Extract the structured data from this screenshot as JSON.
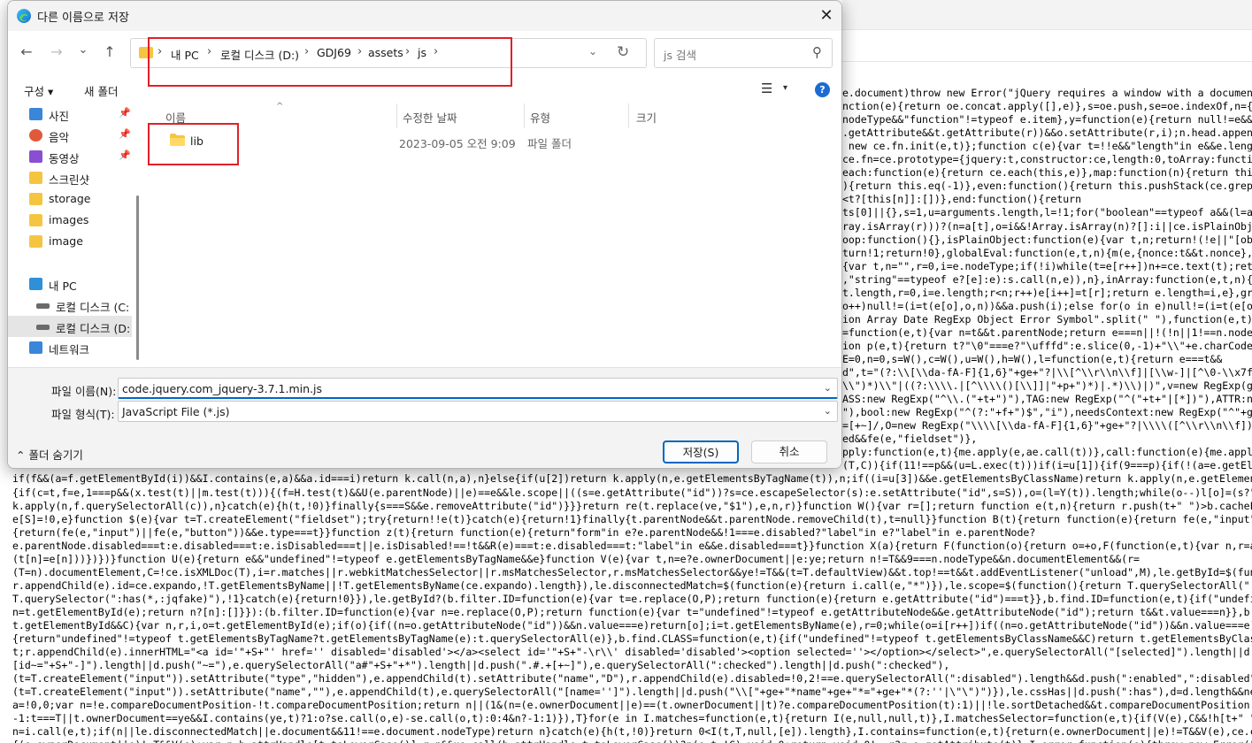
{
  "dialog": {
    "title": "다른 이름으로 저장",
    "close_glyph": "✕"
  },
  "nav": {
    "back": "←",
    "forward": "→",
    "recent": "⌄",
    "up": "↑",
    "breadcrumb": [
      "내 PC",
      "로컬 디스크 (D:)",
      "GDJ69",
      "assets",
      "js"
    ],
    "separator": "›",
    "dropdown": "⌄",
    "refresh": "↻",
    "search_placeholder": "js 검색",
    "search_icon": "⚲"
  },
  "toolbar": {
    "organize": "구성 ▾",
    "new_folder": "새 폴더",
    "view_icon": "☰",
    "view_dd": "▾",
    "help": "?"
  },
  "sidebar": {
    "items": [
      {
        "label": "사진",
        "icon": "pictures-icon",
        "pinned": true
      },
      {
        "label": "음악",
        "icon": "music-icon",
        "pinned": true
      },
      {
        "label": "동영상",
        "icon": "videos-icon",
        "pinned": true
      },
      {
        "label": "스크린샷",
        "icon": "folder-icon",
        "pinned": false
      },
      {
        "label": "storage",
        "icon": "folder-icon",
        "pinned": false
      },
      {
        "label": "images",
        "icon": "folder-icon",
        "pinned": false
      },
      {
        "label": "image",
        "icon": "folder-icon",
        "pinned": false
      },
      {
        "label": "내 PC",
        "icon": "pc-icon",
        "pinned": false
      },
      {
        "label": "로컬 디스크 (C:",
        "icon": "drive-icon",
        "pinned": false
      },
      {
        "label": "로컬 디스크 (D:",
        "icon": "drive-icon",
        "pinned": false
      },
      {
        "label": "네트워크",
        "icon": "network-icon",
        "pinned": false
      }
    ],
    "pin_glyph": "📌"
  },
  "columns": {
    "name": "이름",
    "modified": "수정한 날짜",
    "type": "유형",
    "size": "크기",
    "sort_arrow": "^"
  },
  "files": [
    {
      "name": "lib",
      "modified": "2023-09-05 오전 9:09",
      "type": "파일 폴더",
      "size": ""
    }
  ],
  "form": {
    "filename_label": "파일 이름(N):",
    "filename_value": "code.jquery.com_jquery-3.7.1.min.js",
    "filetype_label": "파일 형식(T):",
    "filetype_value": "JavaScript File (*.js)",
    "dd_glyph": "⌄",
    "hide_folders": "⌃  폴더 숨기기",
    "save": "저장(S)",
    "cancel": "취소"
  },
  "code": {
    "lines": [
      "e.document)throw new Error(\"jQuery requires a window with a document\");return t(e)}:t(e)}(\"undefined\"!=typeof window?window:this",
      "nction(e){return oe.concat.apply([],e)},s=oe.push,se=oe.indexOf,n={},i=n.toString,ue=n.hasOwnProperty,o=ue.toString,a=o.call(Object)",
      "nodeType&&\"function\"!=typeof e.item},y=function(e){return null!=e&&e===e.window},C=ie.document,u={type:!0,src:!0,nonce:!0",
      ".getAttribute&&t.getAttribute(r))&&o.setAttribute(r,i);n.head.appendChild(o).parentNode.removeChild(o)}function x(e){return",
      " new ce.fn.init(e,t)};function c(e){var t=!!e&&\"length\"in e&&e.length,n=x(e);return!v(e)&&!y(e)&&(\"array\"===n||0===t",
      "ce.fn=ce.prototype={jquery:t,constructor:ce,length:0,toArray:function(){return ae.call(this)},get:function(e){return null",
      "each:function(e){return ce.each(this,e)},map:function(n){return this.pushStack(ce.map(this,function(e,t){return n.call(e,t,e)",
      "){return this.eq(-1)},even:function(){return this.pushStack(ce.grep(this,function(e,t){return(t+1)%2}))},odd:function(){return",
      "<t?[this[n]]:[])},end:function(){return",
      "ts[0]||{},s=1,u=arguments.length,l=!1;for(\"boolean\"==typeof a&&(l=a,a=arguments[s]||{},s++),\"object\"==typeof a||v(a)||(a={})",
      "ray.isArray(r)))?(n=a[t],o=i&&!Array.isArray(n)?[]:i||ce.isPlainObject(n)?n:{},i=!1,a[t]=ce.extend(l,o,r)):void 0!==r&&(a[t]=r)",
      "oop:function(){},isPlainObject:function(e){var t,n;return!(!e||\"[object Object]\"!==i.call(e))&&(!(t=r(e))||\"function\"==typeof",
      "turn!1;return!0},globalEval:function(e,t,n){m(e,{nonce:t&&t.nonce},n)},each:function(e,t){var n,r=0;if(c(e)){for(n=e.length",
      "{var t,n=\"\",r=0,i=e.nodeType;if(!i)while(t=e[r++])n+=ce.text(t);return 1===i||11===i?e.textContent:9===i?e.documentElement",
      ",\"string\"==typeof e?[e]:e):s.call(n,e)),n},inArray:function(e,t,n){return null==t?-1:se.call(t,e,n)},isXMLDoc:function(e){var t",
      "t.length,r=0,i=e.length;r<n;r++)e[i++]=t[r];return e.length=i,e},grep:function(e,t,n){for(var r=[],i=0,o=e.length,a=!n;i<o;i++)",
      "o++)null!=(i=t(e[o],o,n))&&a.push(i);else for(o in e)null!=(i=t(e[o],o,n))&&a.push(i);return g(a)},guid:1,support:le}),",
      "ion Array Date RegExp Object Error Symbol\".split(\" \"),function(e,t){n[\"[object \"+t+\"]\"]=t.toLowerCase()});var pe=oe.pop",
      "=function(e,t){var n=t&&t.parentNode;return e===n||!(!n||1!==n.nodeType||!(e.contains?e.contains(n):e.compareDocumentPosition",
      "ion p(e,t){return t?\"\\0\"===e?\"\\ufffd\":e.slice(0,-1)+\"\\\\\"+e.charCodeAt(e.length-1).toString(16)+\" \":\"\\\\\"+e}ce.escapeSelector",
      "E=0,n=0,s=W(),c=W(),u=W(),h=W(),l=function(e,t){return e===t&&",
      "d\",t=\"(?:\\\\[\\\\da-fA-F]{1,6}\"+ge+\"?|\\\\[^\\\\r\\\\n\\\\f]|[\\\\w-]|[^\\0-\\\\x7f])+\",p=\"\\\\[\"+ge+\"*(\"+t+\")(?:\"+ge+\"*([*^$|!~]?=)\"+ge",
      "\\\\\")*)\\\\\"|((?:\\\\\\\\.|[^\\\\\\\\()[\\\\]]|\"+p+\")*)|.*)\\\\)|)\",v=new RegExp(ge+\"+\",\"g\"),y=new RegExp(\"^\"+ge+\"*,\"+ge+\"*\")",
      "ASS:new RegExp(\"^\\\\.(\"+t+\")\"),TAG:new RegExp(\"^(\"+t+\"|[*])\"),ATTR:new RegExp(\"^\"+p),PSEUDO:new RegExp(\"^\"+g),CHILD:new",
      "\"),bool:new RegExp(\"^(?:\"+f+\")$\",\"i\"),needsContext:new RegExp(\"^\"+ge+\"*[>+~]|:(even|odd|eq|gt|lt|nth|first|last)(?:\\\\(\"",
      "=[+~]/,O=new RegExp(\"\\\\\\\\[\\\\da-fA-F]{1,6}\"+ge+\"?|\\\\\\\\([^\\\\r\\\\n\\\\f])\",\"g\"),P=function(e,t){var n=\"0x\"+e.slice(1)-65536",
      "ed&&fe(e,\"fieldset\")},",
      "pply:function(e,t){me.apply(e,ae.call(t))},call:function(e){me.apply(e,ae.call(arguments,1))}}}function I(t,e,n,r){var i,o,a",
      "(T,C)){if(11!==p&&(u=L.exec(t)))if(i=u[1]){if(9===p){if(!(a=e.getElementById(i)))return n;if(a.id===i)return k.call(n,a),n}",
      "if(f&&(a=f.getElementById(i))&&I.contains(e,a)&&a.id===i)return k.call(n,a),n}else{if(u[2])return k.apply(n,e.getElementsByTagName(t)),n;if((i=u[3])&&e.getElementsByClassName)return k.apply(n,e.getElementsByClassName(i)),n}",
      "{if(c=t,f=e,1===p&&(x.test(t)||m.test(t))){(f=H.test(t)&&U(e.parentNode)||e)==e&&le.scope||((s=e.getAttribute(\"id\"))?s=ce.escapeSelector(s):e.setAttribute(\"id\",s=S)),o=(l=Y(t)).length;while(o--)l[o]=(s?\"#\"+s:\":scope\")",
      "k.apply(n,f.querySelectorAll(c)),n}catch(e){h(t,!0)}finally{s===S&&e.removeAttribute(\"id\")}}}return re(t.replace(ve,\"$1\"),e,n,r)}function W(){var r=[];return function e(t,n){return r.push(t+\" \")>b.cacheLength&&delete e[r.shift()]",
      "e[S]=!0,e}function $(e){var t=T.createElement(\"fieldset\");try{return!!e(t)}catch(e){return!1}finally{t.parentNode&&t.parentNode.removeChild(t),t=null}}function B(t){return function(e){return fe(e,\"input\")&&e.type===t}}",
      "{return(fe(e,\"input\")||fe(e,\"button\"))&&e.type===t}}function z(t){return function(e){return\"form\"in e?e.parentNode&&!1===e.disabled?\"label\"in e?\"label\"in e.parentNode?",
      "e.parentNode.disabled===t:e.disabled===t:e.isDisabled===t||e.isDisabled!==!t&&R(e)===t:e.disabled===t:\"label\"in e&&e.disabled===t}}function X(a){return F(function(o){return o=+o,F(function(e,t){var n,r=a([],e.length,o)",
      "(t[n]=e[n]))})})}function U(e){return e&&\"undefined\"!=typeof e.getElementsByTagName&&e}function V(e){var t,n=e?e.ownerDocument||e:ye;return n!=T&&9===n.nodeType&&n.documentElement&&(r=",
      "(T=n).documentElement,C=!ce.isXMLDoc(T),i=r.matches||r.webkitMatchesSelector||r.msMatchesSelector,r.msMatchesSelector&&ye!=T&&(t=T.defaultView)&&t.top!==t&&t.addEventListener(\"unload\",M),le.getById=$(function(e){return",
      "r.appendChild(e).id=ce.expando,!T.getElementsByName||!T.getElementsByName(ce.expando).length}),le.disconnectedMatch=$(function(e){return i.call(e,\"*\")}),le.scope=$(function(){return T.querySelectorAll(\":scope\")}),le.cssHas=$(function(){try{return",
      "T.querySelector(\":has(*,:jqfake)\"),!1}catch(e){return!0}}),le.getById?(b.filter.ID=function(e){var t=e.replace(O,P);return function(e){return e.getAttribute(\"id\")===t}},b.find.ID=function(e,t){if(\"undefined\"!=typeof",
      "n=t.getElementById(e);return n?[n]:[]}}):(b.filter.ID=function(e){var n=e.replace(O,P);return function(e){var t=\"undefined\"!=typeof e.getAttributeNode&&e.getAttributeNode(\"id\");return t&&t.value===n}},b.find.ID=function(e,t){if(",
      "t.getElementById&&C){var n,r,i,o=t.getElementById(e);if(o){if((n=o.getAttributeNode(\"id\"))&&n.value===e)return[o];i=t.getElementsByName(e),r=0;while(o=i[r++])if((n=o.getAttributeNode(\"id\"))&&n.value===e)return[o]}return[]}}),b.find.TAG=function(e,t){",
      "{return\"undefined\"!=typeof t.getElementsByTagName?t.getElementsByTagName(e):t.querySelectorAll(e)},b.find.CLASS=function(e,t){if(\"undefined\"!=typeof t.getElementsByClassName&&C)return t.getElementsByClassName(e)},d=[],$(function(e){var",
      "t;r.appendChild(e).innerHTML=\"<a id='\"+S+\"' href='' disabled='disabled'></a><select id='\"+S+\"-\\r\\\\' disabled='disabled'><option selected=''></option></select>\",e.querySelectorAll(\"[selected]\").length||d.push(\"\\\\[\"+ge+\"*(?:value|\"+f+\")\"),e.querySelectorAll(\"",
      "[id~=\"+S+\"-]\").length||d.push(\"~=\"),e.querySelectorAll(\"a#\"+S+\"+*\").length||d.push(\".#.+[+~]\"),e.querySelectorAll(\":checked\").length||d.push(\":checked\"),",
      "(t=T.createElement(\"input\")).setAttribute(\"type\",\"hidden\"),e.appendChild(t).setAttribute(\"name\",\"D\"),r.appendChild(e).disabled=!0,2!==e.querySelectorAll(\":disabled\").length&&d.push(\":enabled\",\":disabled\"),",
      "(t=T.createElement(\"input\")).setAttribute(\"name\",\"\"),e.appendChild(t),e.querySelectorAll(\"[name='']\").length||d.push(\"\\\\[\"+ge+\"*name\"+ge+\"*=\"+ge+\"*(?:''|\\\"\\\")\")}),le.cssHas||d.push(\":has\"),d=d.length&&new RegExp(d.join(\"|\")),l=function(e,t){if(e===t)return",
      "a=!0,0;var n=!e.compareDocumentPosition-!t.compareDocumentPosition;return n||(1&(n=(e.ownerDocument||e)==(t.ownerDocument||t)?e.compareDocumentPosition(t):1)||!le.sortDetached&&t.compareDocumentPosition(e)===n?e===T||e.ownerDocument==ye&&",
      "-1:t===T||t.ownerDocument==ye&&I.contains(ye,t)?1:o?se.call(o,e)-se.call(o,t):0:4&n?-1:1)}),T}for(e in I.matches=function(e,t){return I(e,null,null,t)},I.matchesSelector=function(e,t){if(V(e),C&&!h[t+\" \"]&&(!d||!d.test(t)))try{var n=i.call(e,t);if(n||",
      "n=i.call(e,t);if(n||le.disconnectedMatch||e.document&&11!==e.document.nodeType)return n}catch(e){h(t,!0)}return 0<I(t,T,null,[e]).length},I.contains=function(e,t){return(e.ownerDocument||e)!=T&&V(e),ce.contains(e,t)},I.attr=function(e,t){",
      "{(e.ownerDocument||e)!=T&&V(e);var n=b.attrHandle[t.toLowerCase()],r=n&&ue.call(b.attrHandle,t.toLowerCase())?n(e,t,!C):void 0;return void 0!==r?r:e.getAttribute(t)},I.error=function(e){throw new Error(\"Syntax error, unrecognized expression: \"+e)}"
    ]
  }
}
